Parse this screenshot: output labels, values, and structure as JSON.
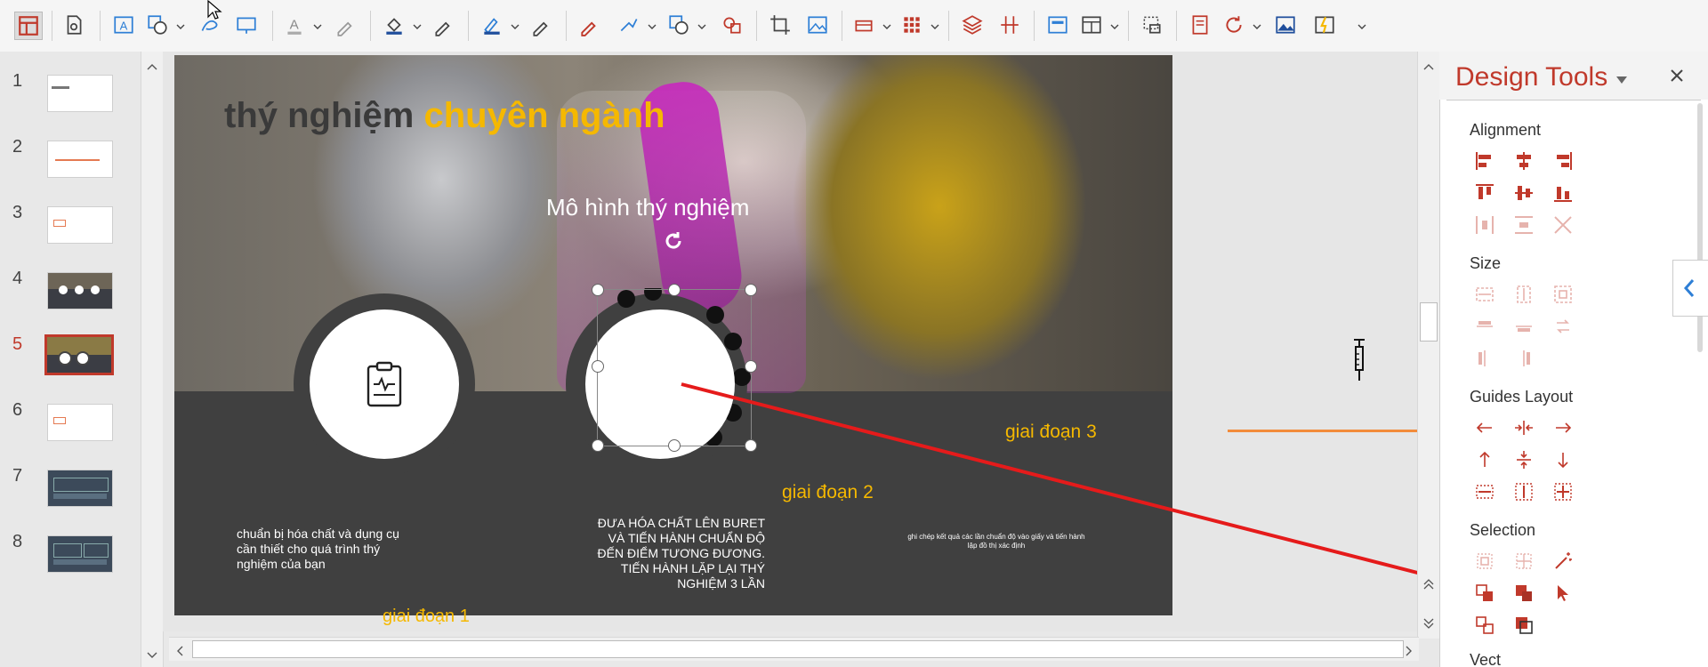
{
  "slides": [
    {
      "number": "1",
      "dark": false
    },
    {
      "number": "2",
      "dark": false
    },
    {
      "number": "3",
      "dark": false
    },
    {
      "number": "4",
      "dark": true
    },
    {
      "number": "5",
      "dark": true,
      "selected": true
    },
    {
      "number": "6",
      "dark": false
    },
    {
      "number": "7",
      "dark": true
    },
    {
      "number": "8",
      "dark": true
    }
  ],
  "slide": {
    "title_dark": "thý nghiệm",
    "title_yellow": "chuyên ngành",
    "subtitle": "Mô hình thý nghiệm",
    "stage1_label": "giai đoạn 1",
    "stage2_label": "giai đoạn 2",
    "stage3_label": "giai đoạn 3",
    "stage1_text": "chuẩn bị hóa chất và dụng cụ cần thiết cho quá trình thý nghiệm của bạn",
    "stage2_text": "ĐƯA HÓA CHẤT LÊN BURET VÀ TIẾN HÀNH CHUẨN ĐỘ ĐẾN ĐIỂM TƯƠNG ĐƯƠNG. TIẾN HÀNH LẶP LẠI THÝ NGHIỆM 3 LẦN",
    "stage3_text": "ghi chép kết quả các lần chuẩn độ vào giấy và tiến hành lập đồ thị xác định"
  },
  "panel": {
    "title": "Design Tools",
    "sections": {
      "alignment": "Alignment",
      "size": "Size",
      "guides": "Guides Layout",
      "selection": "Selection",
      "next": "Vect"
    }
  },
  "colors": {
    "accent": "#c0392b",
    "yellow": "#f5b800",
    "slide_dark": "#404040",
    "orange_line": "#f28c3b",
    "arrow": "#e51b1b",
    "panel_blue": "#2e7fd6"
  }
}
